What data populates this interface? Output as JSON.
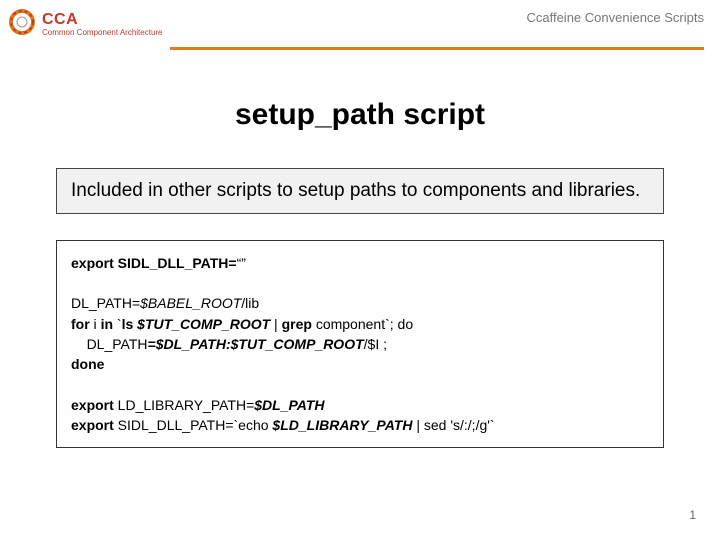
{
  "header": {
    "logo_abbrev": "CCA",
    "logo_subtitle": "Common Component Architecture",
    "right_text": "Ccaffeine Convenience Scripts"
  },
  "title": "setup_path script",
  "description": "Included in other scripts to setup paths to components and libraries.",
  "code": {
    "l1a": "export SIDL_DLL_PATH=",
    "l1b": "“”",
    "l2a": "DL_PATH=",
    "l2b": "$BABEL_ROOT",
    "l2c": "/lib",
    "l3a": "for",
    "l3b": " i ",
    "l3c": "in",
    "l3d": " `",
    "l3e": "ls ",
    "l3f": "$TUT_COMP_ROOT",
    "l3g": " | ",
    "l3h": "grep",
    "l3i": " component`; do",
    "l4a": "    DL_PATH",
    "l4b": "=$DL_PATH:$TUT_COMP_ROOT",
    "l4c": "/$I ;",
    "l5": "done",
    "l6a": "export",
    "l6b": " LD_LIBRARY_PATH=",
    "l6c": "$DL_PATH",
    "l7a": "export",
    "l7b": " SIDL_DLL_PATH=`echo ",
    "l7c": "$LD_LIBRARY_PATH",
    "l7d": " | sed 's/:/;/g'`"
  },
  "page_number": "1",
  "colors": {
    "accent_orange": "#e17a1a",
    "logo_red": "#c23a2a"
  }
}
